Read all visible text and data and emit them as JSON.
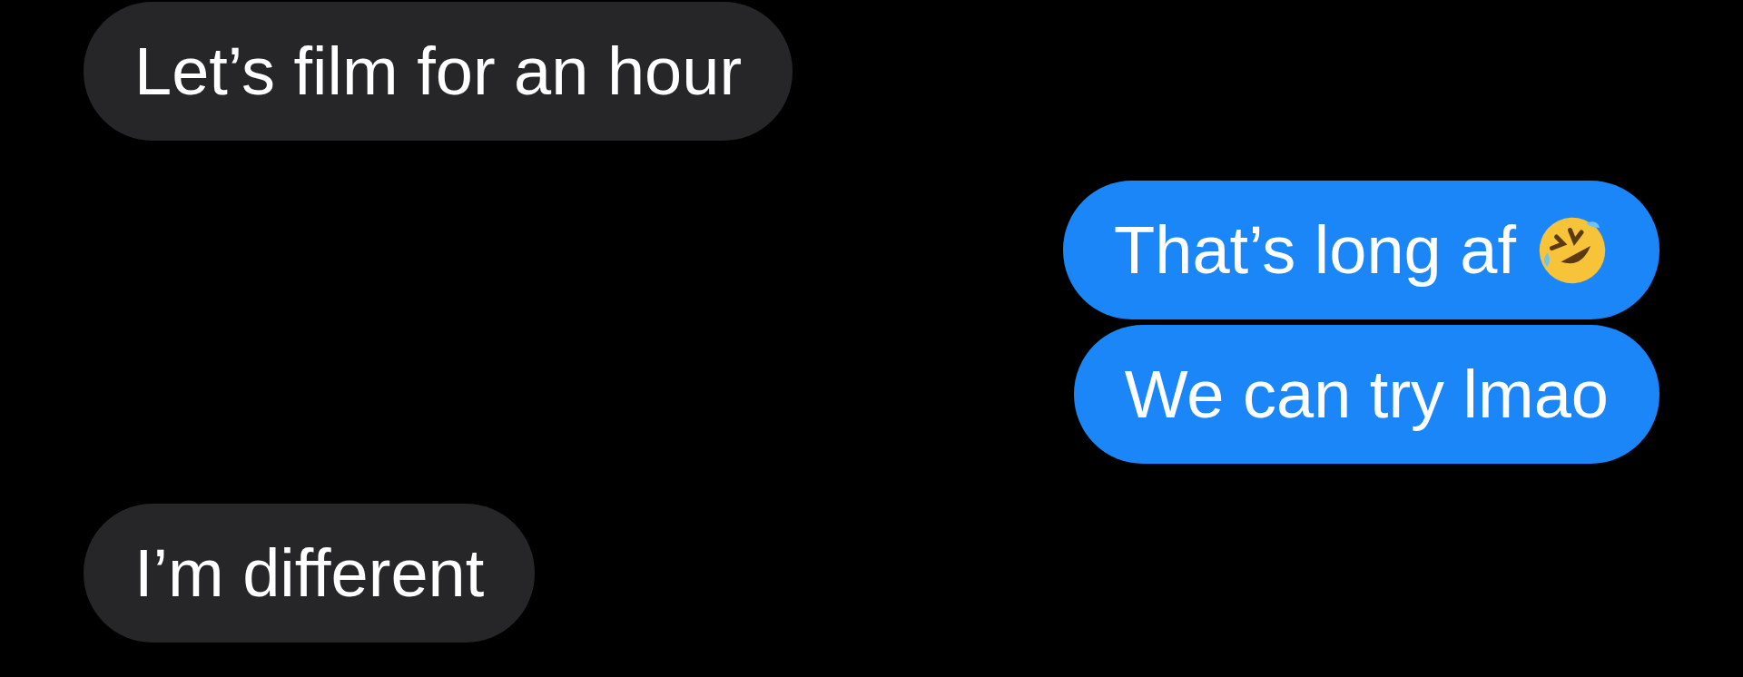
{
  "messages": [
    {
      "kind": "received",
      "text": "Let’s film for an hour",
      "trailing_icon": false
    },
    {
      "kind": "sent",
      "text": "That’s long af",
      "trailing_icon": true
    },
    {
      "kind": "sent",
      "text": "We can try lmao",
      "trailing_icon": false
    },
    {
      "kind": "received",
      "text": "I’m different",
      "trailing_icon": false
    }
  ]
}
